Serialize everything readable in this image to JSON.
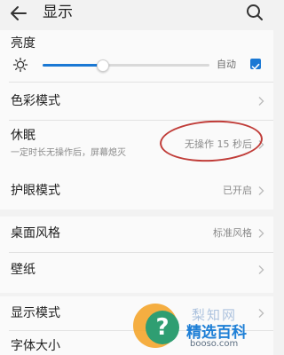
{
  "header": {
    "title": "显示"
  },
  "brightness": {
    "label": "亮度",
    "auto_label": "自动",
    "level": 0.36,
    "auto_checked": true
  },
  "items": {
    "color_mode": {
      "label": "色彩模式"
    },
    "sleep": {
      "label": "休眠",
      "subtitle": "一定时长无操作后，屏幕熄灭",
      "value": "无操作 15 秒后"
    },
    "eye_protection": {
      "label": "护眼模式",
      "value": "已开启"
    },
    "desktop_style": {
      "label": "桌面风格",
      "value": "标准风格"
    },
    "wallpaper": {
      "label": "壁纸"
    },
    "display_mode": {
      "label": "显示模式"
    },
    "font_size": {
      "label": "字体大小"
    }
  },
  "watermark": {
    "mark": "?",
    "top_text": "梨知网",
    "brand": "精选百科",
    "site": "booso.com"
  },
  "colors": {
    "accent": "#1a78d4",
    "annotation": "#c03c38"
  }
}
